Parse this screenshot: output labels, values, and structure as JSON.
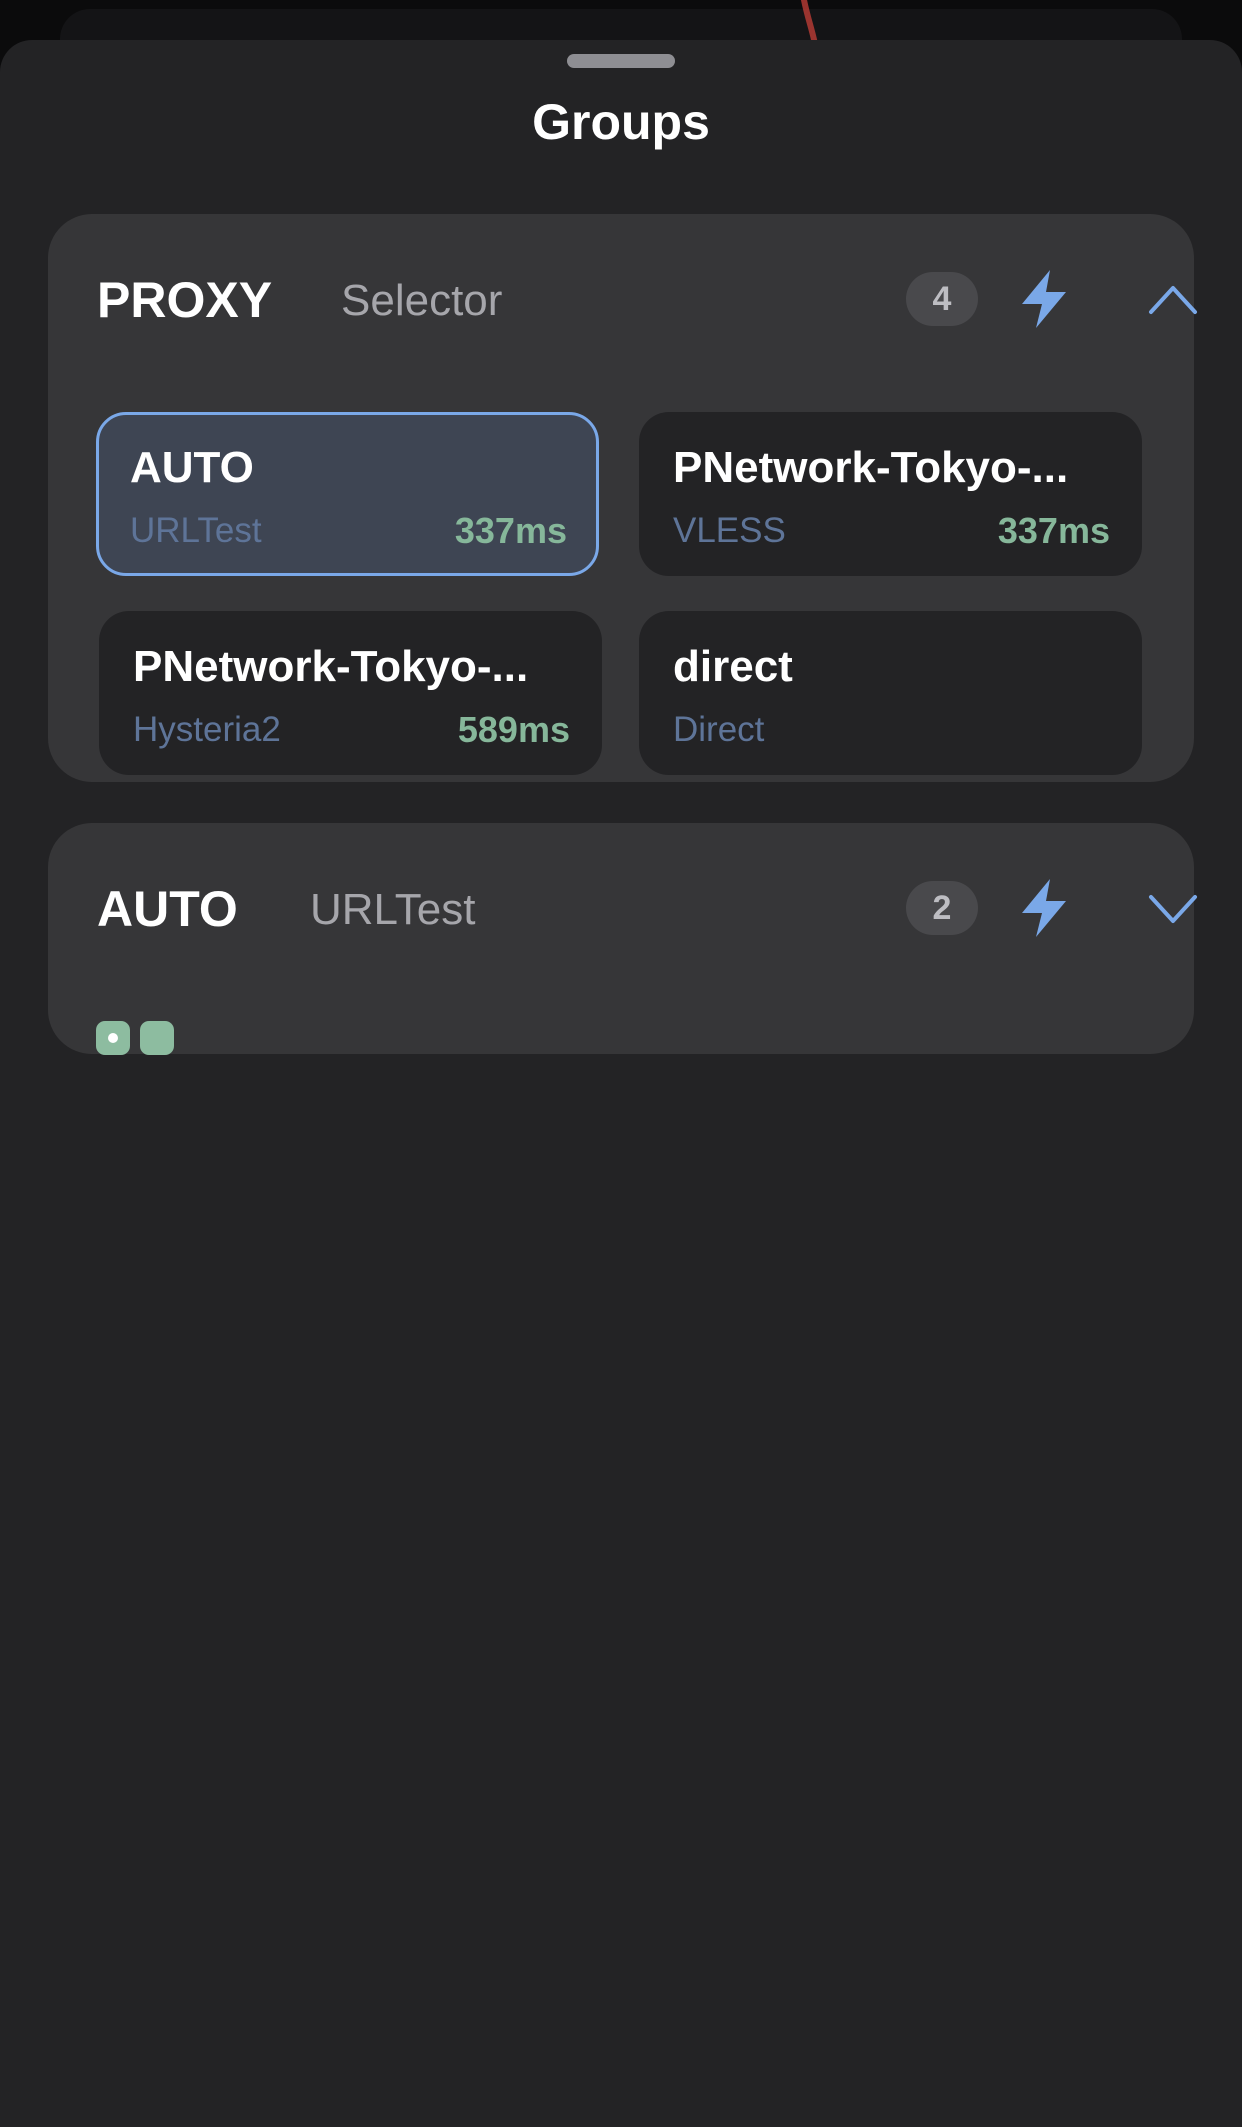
{
  "sheet": {
    "title": "Groups"
  },
  "colors": {
    "accent_blue": "#7aa8e8",
    "latency_green": "#86b79a",
    "sheet_background": "#232325",
    "card_background": "#363638",
    "selected_node_background": "#3e4553",
    "node_type_text": "#5e7498"
  },
  "groups": [
    {
      "name": "PROXY",
      "type": "Selector",
      "count": "4",
      "expanded": true,
      "test_icon": "lightning-bolt-icon",
      "toggle_icon": "chevron-up-icon",
      "nodes": [
        {
          "name": "AUTO",
          "type": "URLTest",
          "delay": "337ms",
          "selected": true
        },
        {
          "name": "PNetwork-Tokyo-...",
          "type": "VLESS",
          "delay": "337ms",
          "selected": false
        },
        {
          "name": "PNetwork-Tokyo-...",
          "type": "Hysteria2",
          "delay": "589ms",
          "selected": false
        },
        {
          "name": "direct",
          "type": "Direct",
          "delay": "",
          "selected": false
        }
      ]
    },
    {
      "name": "AUTO",
      "type": "URLTest",
      "count": "2",
      "expanded": false,
      "test_icon": "lightning-bolt-icon",
      "toggle_icon": "chevron-down-icon",
      "node_indicators": [
        {
          "selected": true
        },
        {
          "selected": false
        }
      ]
    }
  ]
}
